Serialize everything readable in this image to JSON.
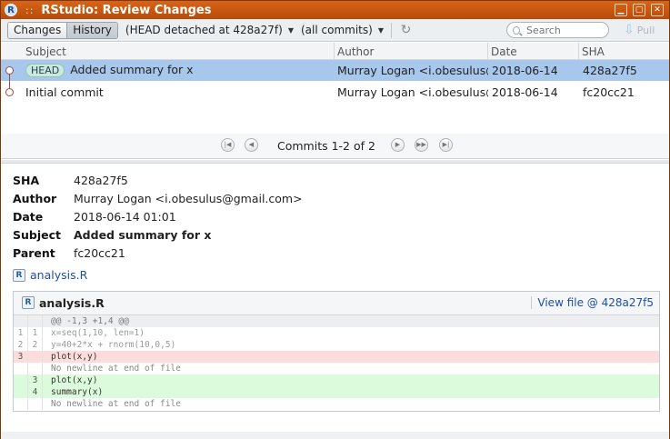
{
  "window": {
    "title": "RStudio: Review Changes",
    "icon_letter": "R",
    "drag_dots": "::"
  },
  "toolbar": {
    "changes_label": "Changes",
    "history_label": "History",
    "branch_label": "(HEAD detached at 428a27f)",
    "commits_filter": "(all commits)",
    "search_placeholder": "Search",
    "pull_label": "Pull"
  },
  "table": {
    "columns": [
      "Subject",
      "Author",
      "Date",
      "SHA"
    ],
    "rows": [
      {
        "tag": "HEAD",
        "subject": "Added summary for x",
        "author": "Murray Logan <i.obesulus@gmail.com>",
        "date": "2018-06-14",
        "sha": "428a27f5",
        "selected": true
      },
      {
        "tag": "",
        "subject": "Initial commit",
        "author": "Murray Logan <i.obesulus@gmail.com>",
        "date": "2018-06-14",
        "sha": "fc20cc21",
        "selected": false
      }
    ]
  },
  "pager": {
    "text": "Commits 1-2 of 2"
  },
  "details": {
    "sha_label": "SHA",
    "sha": "428a27f5",
    "author_label": "Author",
    "author": "Murray Logan <i.obesulus@gmail.com>",
    "date_label": "Date",
    "date": "2018-06-14 01:01",
    "subject_label": "Subject",
    "subject": "Added summary for x",
    "parent_label": "Parent",
    "parent": "fc20cc21",
    "file_link": "analysis.R"
  },
  "diff": {
    "file": "analysis.R",
    "view_file": "View file @ 428a27f5",
    "lines": [
      {
        "kind": "hunk",
        "a": "",
        "b": "",
        "text": "@@ -1,3 +1,4 @@"
      },
      {
        "kind": "ctx",
        "a": "1",
        "b": "1",
        "text": "x=seq(1,10, len=1)"
      },
      {
        "kind": "ctx",
        "a": "2",
        "b": "2",
        "text": "y=40+2*x + rnorm(10,0,5)"
      },
      {
        "kind": "del",
        "a": "3",
        "b": "",
        "text": "plot(x,y)"
      },
      {
        "kind": "note",
        "a": "",
        "b": "",
        "text": " No newline at end of file"
      },
      {
        "kind": "add",
        "a": "",
        "b": "3",
        "text": "plot(x,y)"
      },
      {
        "kind": "add",
        "a": "",
        "b": "4",
        "text": "summary(x)"
      },
      {
        "kind": "note",
        "a": "",
        "b": "",
        "text": " No newline at end of file"
      }
    ]
  },
  "colors": {
    "titlebar": "#c85510",
    "selection": "#a8c7ec",
    "deleted": "#fcdcdc",
    "added": "#dcfadc",
    "link": "#2050a0"
  }
}
